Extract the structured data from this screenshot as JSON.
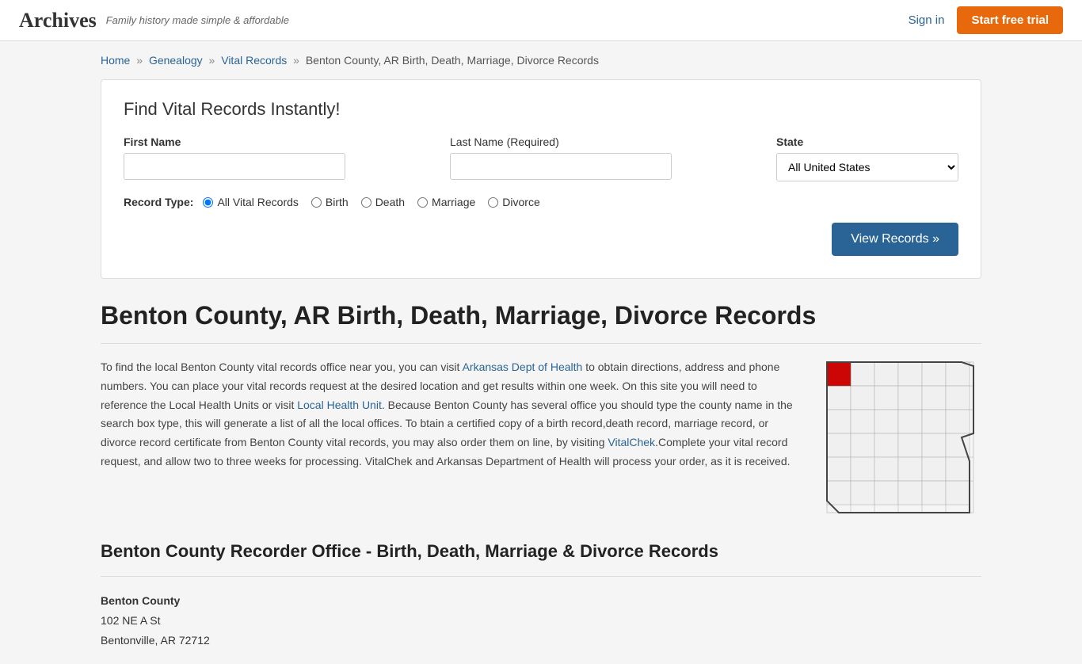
{
  "header": {
    "logo": "Archives",
    "tagline": "Family history made simple & affordable",
    "signin_label": "Sign in",
    "trial_button": "Start free trial"
  },
  "breadcrumb": {
    "home": "Home",
    "genealogy": "Genealogy",
    "vital_records": "Vital Records",
    "current": "Benton County, AR Birth, Death, Marriage, Divorce Records"
  },
  "search": {
    "title": "Find Vital Records Instantly!",
    "first_name_label": "First Name",
    "last_name_label": "Last Name",
    "last_name_required": "(Required)",
    "state_label": "State",
    "state_default": "All United States",
    "record_type_label": "Record Type:",
    "record_types": [
      "All Vital Records",
      "Birth",
      "Death",
      "Marriage",
      "Divorce"
    ],
    "view_records_btn": "View Records »"
  },
  "page": {
    "title": "Benton County, AR Birth, Death, Marriage, Divorce Records",
    "body": "To find the local Benton County vital records office near you, you can visit Arkansas Dept of Health to obtain directions, address and phone numbers. You can place your vital records request at the desired location and get results within one week. On this site you will need to reference the Local Health Units or visit Local Health Unit. Because Benton County has several office you should type the county name in the search box type, this will generate a list of all the local offices. To btain a certified copy of a birth record,death record, marriage record, or divorce record certificate from Benton County vital records, you may also order them on line, by visiting VitalChek.Complete your vital record request, and allow two to three weeks for processing. VitalChek and Arkansas Department of Health will process your order, as it is received."
  },
  "section2": {
    "title": "Benton County Recorder Office - Birth, Death, Marriage & Divorce Records",
    "county_name": "Benton County",
    "address1": "102 NE A St",
    "address2": "Bentonville, AR 72712"
  }
}
